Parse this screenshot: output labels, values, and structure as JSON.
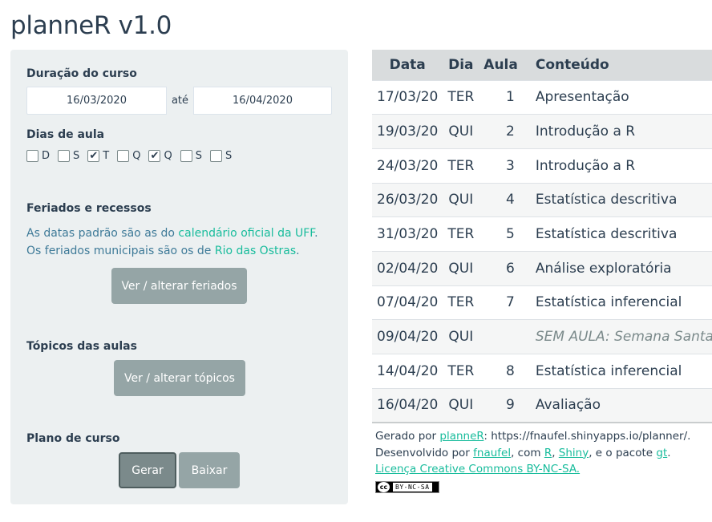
{
  "app": {
    "title": "planneR v1.0"
  },
  "sidebar": {
    "duration": {
      "label": "Duração do curso",
      "start": "16/03/2020",
      "separator": "até",
      "end": "16/04/2020"
    },
    "days": {
      "label": "Dias de aula",
      "items": [
        {
          "label": "D",
          "checked": false
        },
        {
          "label": "S",
          "checked": false
        },
        {
          "label": "T",
          "checked": true
        },
        {
          "label": "Q",
          "checked": false
        },
        {
          "label": "Q",
          "checked": true
        },
        {
          "label": "S",
          "checked": false
        },
        {
          "label": "S",
          "checked": false
        }
      ]
    },
    "holidays": {
      "label": "Feriados e recessos",
      "line1_prefix": "As datas padrão são as do ",
      "line1_link": "calendário oficial da UFF",
      "line1_suffix": ".",
      "line2_prefix": "Os feriados municipais são os de ",
      "line2_link": "Rio das Ostras",
      "line2_suffix": ".",
      "button": "Ver / alterar feriados"
    },
    "topics": {
      "label": "Tópicos das aulas",
      "button": "Ver / alterar tópicos"
    },
    "plan": {
      "label": "Plano de curso",
      "generate": "Gerar",
      "download": "Baixar"
    }
  },
  "table": {
    "headers": [
      "Data",
      "Dia",
      "Aula",
      "Conteúdo"
    ],
    "rows": [
      {
        "data": "17/03/20",
        "dia": "TER",
        "aula": "1",
        "conteudo": "Apresentação"
      },
      {
        "data": "19/03/20",
        "dia": "QUI",
        "aula": "2",
        "conteudo": "Introdução a R"
      },
      {
        "data": "24/03/20",
        "dia": "TER",
        "aula": "3",
        "conteudo": "Introdução a R"
      },
      {
        "data": "26/03/20",
        "dia": "QUI",
        "aula": "4",
        "conteudo": "Estatística descritiva"
      },
      {
        "data": "31/03/20",
        "dia": "TER",
        "aula": "5",
        "conteudo": "Estatística descritiva"
      },
      {
        "data": "02/04/20",
        "dia": "QUI",
        "aula": "6",
        "conteudo": "Análise exploratória"
      },
      {
        "data": "07/04/20",
        "dia": "TER",
        "aula": "7",
        "conteudo": "Estatística inferencial"
      },
      {
        "data": "09/04/20",
        "dia": "QUI",
        "aula": "",
        "conteudo": "SEM AULA: Semana Santa"
      },
      {
        "data": "14/04/20",
        "dia": "TER",
        "aula": "8",
        "conteudo": "Estatística inferencial"
      },
      {
        "data": "16/04/20",
        "dia": "QUI",
        "aula": "9",
        "conteudo": "Avaliação"
      }
    ]
  },
  "footnote": {
    "line1_prefix": "Gerado por ",
    "line1_link": "planneR",
    "line1_suffix": ": https://fnaufel.shinyapps.io/planner/.",
    "line2_prefix": "Desenvolvido por ",
    "line2_link1": "fnaufel",
    "line2_sep1": ", com ",
    "line2_link2": "R",
    "line2_sep2": ", ",
    "line2_link3": "Shiny",
    "line2_sep3": ", e o pacote ",
    "line2_link4": "gt",
    "line2_suffix": ".",
    "line3_link": "Licença Creative Commons BY-NC-SA.",
    "badge_text": "BY-NC-SA",
    "badge_cc": "cc"
  },
  "colors": {
    "primary": "#2c3e50",
    "accent": "#18bc9c",
    "sidebar_bg": "#ecf0f1",
    "button": "#95a5a6"
  }
}
